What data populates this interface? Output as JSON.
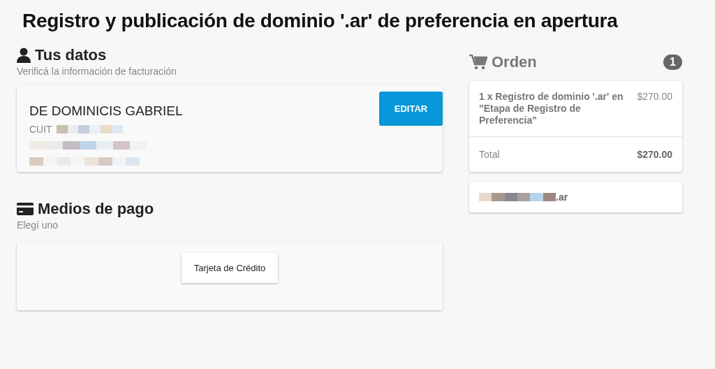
{
  "title": "Registro y publicación de dominio '.ar' de preferencia en apertura",
  "profile": {
    "heading": "Tus datos",
    "subtitle": "Verificá la información de facturación",
    "name": "DE DOMINICIS GABRIEL",
    "cuit_label": "CUIT",
    "edit_button": "EDITAR"
  },
  "payment": {
    "heading": "Medios de pago",
    "subtitle": "Elegí uno",
    "options": [
      "Tarjeta de Crédito"
    ]
  },
  "order": {
    "heading": "Orden",
    "count": "1",
    "items": [
      {
        "description": "1 x Registro de dominio '.ar' en \"Etapa de Registro de Preferencia\"",
        "price": "$270.00"
      }
    ],
    "total_label": "Total",
    "total": "$270.00",
    "domain_suffix": ".ar"
  }
}
